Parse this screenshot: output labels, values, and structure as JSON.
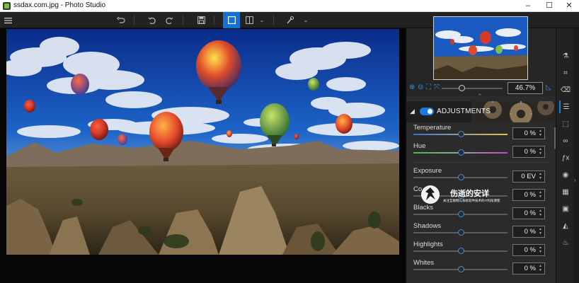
{
  "window": {
    "title": "ssdax.com.jpg - Photo Studio",
    "controls": [
      "–",
      "☐",
      "✕"
    ]
  },
  "toolbar": {
    "icons": [
      "menu-icon",
      "undo-icon",
      "undo-step-icon",
      "redo-icon",
      "save-icon",
      "single-view-icon",
      "split-view-icon",
      "dropdown-chevron-icon",
      "brush-icon",
      "brush-dropdown-icon"
    ],
    "active": "single-view-icon"
  },
  "navigator": {
    "zoom_value": "46.7%",
    "zoom_fraction": 0.33
  },
  "adjustments": {
    "title": "ADJUSTMENTS",
    "enabled": true,
    "rows": [
      {
        "label": "Temperature",
        "value": "0 %",
        "level": 0.5
      },
      {
        "label": "Hue",
        "value": "0 %",
        "level": 0.5
      },
      {
        "label": "Exposure",
        "value": "0 EV",
        "level": 0.5
      },
      {
        "label": "Co",
        "value": "0 %",
        "level": 0.5
      },
      {
        "label": "Blacks",
        "value": "0 %",
        "level": 0.5
      },
      {
        "label": "Shadows",
        "value": "0 %",
        "level": 0.5
      },
      {
        "label": "Highlights",
        "value": "0 %",
        "level": 0.5
      },
      {
        "label": "Whites",
        "value": "0 %",
        "level": 0.5
      }
    ]
  },
  "watermark": {
    "name": "伤逝的安详",
    "subtitle": "关注互联网与系统软件技术的IT科技博客"
  },
  "tools": [
    "flask-icon",
    "crop-icon",
    "eraser-icon",
    "sliders-icon",
    "selection-icon",
    "glasses-icon",
    "fx-icon",
    "palette-icon",
    "grain-icon",
    "frame-icon",
    "fill-icon",
    "stamp-icon"
  ],
  "colors": {
    "accent": "#1273d4",
    "panel": "#2b2b2b",
    "toolbar": "#222222"
  }
}
